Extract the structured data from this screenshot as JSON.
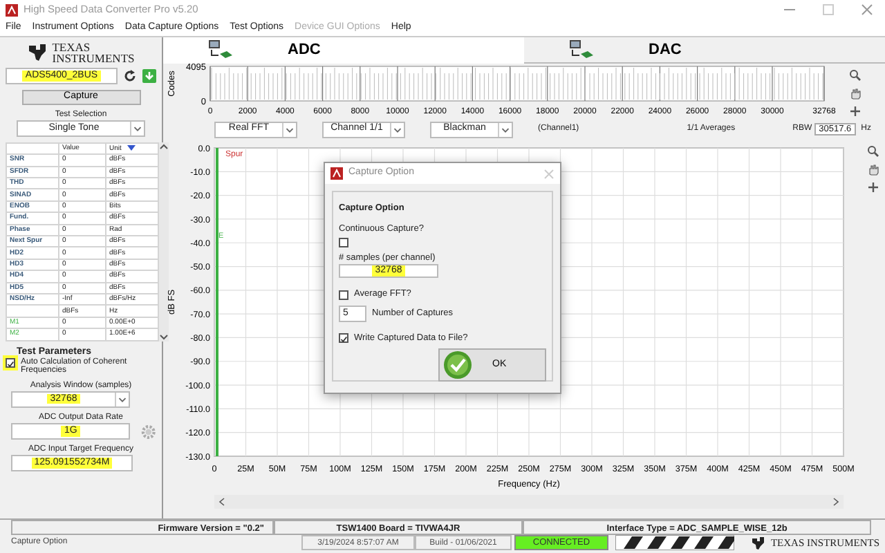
{
  "window": {
    "title": "High Speed Data Converter Pro v5.20"
  },
  "menu": [
    {
      "label": "File",
      "disabled": false
    },
    {
      "label": "Instrument Options",
      "disabled": false
    },
    {
      "label": "Data Capture Options",
      "disabled": false
    },
    {
      "label": "Test Options",
      "disabled": false
    },
    {
      "label": "Device GUI Options",
      "disabled": true
    },
    {
      "label": "Help",
      "disabled": false
    }
  ],
  "logo": {
    "line_1": "TEXAS",
    "line_2": "INSTRUMENTS"
  },
  "device": {
    "value": "ADS5400_2BUS",
    "highlighted": true
  },
  "capture_button": "Capture",
  "test_selection": {
    "label": "Test Selection",
    "value": "Single Tone"
  },
  "results": {
    "columns": [
      "Value",
      "Unit"
    ],
    "rows": [
      {
        "name": "SNR",
        "value": "0",
        "unit": "dBFs",
        "kind": "metric"
      },
      {
        "name": "SFDR",
        "value": "0",
        "unit": "dBFs",
        "kind": "metric"
      },
      {
        "name": "THD",
        "value": "0",
        "unit": "dBFs",
        "kind": "metric"
      },
      {
        "name": "SINAD",
        "value": "0",
        "unit": "dBFs",
        "kind": "metric"
      },
      {
        "name": "ENOB",
        "value": "0",
        "unit": "Bits",
        "kind": "metric"
      },
      {
        "name": "Fund.",
        "value": "0",
        "unit": "dBFs",
        "kind": "metric"
      },
      {
        "name": "Phase",
        "value": "0",
        "unit": "Rad",
        "kind": "metric"
      },
      {
        "name": "Next Spur",
        "value": "0",
        "unit": "dBFs",
        "kind": "metric"
      },
      {
        "name": "HD2",
        "value": "0",
        "unit": "dBFs",
        "kind": "metric"
      },
      {
        "name": "HD3",
        "value": "0",
        "unit": "dBFs",
        "kind": "metric"
      },
      {
        "name": "HD4",
        "value": "0",
        "unit": "dBFs",
        "kind": "metric"
      },
      {
        "name": "HD5",
        "value": "0",
        "unit": "dBFs",
        "kind": "metric"
      },
      {
        "name": "NSD/Hz",
        "value": "-Inf",
        "unit": "dBFs/Hz",
        "kind": "metric"
      },
      {
        "value": "dBFs",
        "unit": "Hz",
        "kind": "header"
      },
      {
        "name": "M1",
        "value": "0",
        "unit": "0.00E+0",
        "kind": "marker"
      },
      {
        "name": "M2",
        "value": "0",
        "unit": "1.00E+6",
        "kind": "marker"
      }
    ]
  },
  "test_parameters": {
    "title": "Test Parameters",
    "auto_coherent": {
      "label": "Auto Calculation of Coherent Frequencies",
      "checked": true,
      "highlighted": true
    },
    "fields": [
      {
        "label": "Analysis Window (samples)",
        "value": "32768",
        "kind": "select",
        "highlighted": true
      },
      {
        "label": "ADC Output Data Rate",
        "value": "1G",
        "kind": "text",
        "highlighted": true
      },
      {
        "label": "ADC Input Target Frequency",
        "value": "125.091552734M",
        "kind": "text",
        "highlighted": true
      }
    ]
  },
  "tabs": [
    {
      "label": "ADC",
      "selected": true
    },
    {
      "label": "DAC",
      "selected": false
    }
  ],
  "code_plot": {
    "chart_data": {
      "type": "line",
      "grid": true,
      "ylabel": "Codes",
      "xlim": [
        0,
        32768
      ],
      "ylim": [
        0,
        4095
      ],
      "yticks": [
        0,
        4095
      ],
      "xticks": [
        0,
        2000,
        4000,
        6000,
        8000,
        10000,
        12000,
        14000,
        16000,
        18000,
        20000,
        22000,
        24000,
        26000,
        28000,
        30000,
        32768
      ]
    }
  },
  "controls": {
    "fft_type": "Real FFT",
    "channel": "Channel 1/1",
    "window": "Blackman",
    "channel_name": "(Channel1)",
    "averages": "1/1 Averages",
    "rbw_label": "RBW",
    "rbw_value": "30517.6",
    "rbw_unit": "Hz"
  },
  "fft_plot": {
    "spur_label": "Spur",
    "marker_label": "E",
    "chart_data": {
      "type": "line",
      "grid": true,
      "xlabel": "Frequency (Hz)",
      "ylabel": "dB FS",
      "xlim": [
        0,
        500000000
      ],
      "ylim": [
        -130,
        0
      ],
      "xticks": [
        {
          "value": 0,
          "label": "0"
        },
        {
          "value": 25000000,
          "label": "25M"
        },
        {
          "value": 50000000,
          "label": "50M"
        },
        {
          "value": 75000000,
          "label": "75M"
        },
        {
          "value": 100000000,
          "label": "100M"
        },
        {
          "value": 125000000,
          "label": "125M"
        },
        {
          "value": 150000000,
          "label": "150M"
        },
        {
          "value": 175000000,
          "label": "175M"
        },
        {
          "value": 200000000,
          "label": "200M"
        },
        {
          "value": 225000000,
          "label": "225M"
        },
        {
          "value": 250000000,
          "label": "250M"
        },
        {
          "value": 275000000,
          "label": "275M"
        },
        {
          "value": 300000000,
          "label": "300M"
        },
        {
          "value": 325000000,
          "label": "325M"
        },
        {
          "value": 350000000,
          "label": "350M"
        },
        {
          "value": 375000000,
          "label": "375M"
        },
        {
          "value": 400000000,
          "label": "400M"
        },
        {
          "value": 425000000,
          "label": "425M"
        },
        {
          "value": 450000000,
          "label": "450M"
        },
        {
          "value": 475000000,
          "label": "475M"
        },
        {
          "value": 500000000,
          "label": "500M"
        }
      ],
      "yticks": [
        {
          "value": 0,
          "label": "0.0"
        },
        {
          "value": -10,
          "label": "-10.0"
        },
        {
          "value": -20,
          "label": "-20.0"
        },
        {
          "value": -30,
          "label": "-30.0"
        },
        {
          "value": -40,
          "label": "-40.0"
        },
        {
          "value": -50,
          "label": "-50.0"
        },
        {
          "value": -60,
          "label": "-60.0"
        },
        {
          "value": -70,
          "label": "-70.0"
        },
        {
          "value": -80,
          "label": "-80.0"
        },
        {
          "value": -90,
          "label": "-90.0"
        },
        {
          "value": -100,
          "label": "-100.0"
        },
        {
          "value": -110,
          "label": "-110.0"
        },
        {
          "value": -120,
          "label": "-120.0"
        },
        {
          "value": -130,
          "label": "-130.0"
        }
      ]
    }
  },
  "dialog": {
    "title": "Capture Option",
    "heading": "Capture Option",
    "continuous": {
      "label": "Continuous Capture?",
      "checked": false
    },
    "samples": {
      "label": "# samples (per channel)",
      "value": "32768",
      "highlighted": true
    },
    "average": {
      "label": "Average FFT?",
      "checked": false
    },
    "captures": {
      "value": "5",
      "label": "Number of Captures"
    },
    "write_file": {
      "label": "Write Captured Data to File?",
      "checked": true
    },
    "ok_button": "OK"
  },
  "status_bar": {
    "firmware": "Firmware Version = \"0.2\"",
    "board": "TSW1400 Board = TIVWA4JR",
    "interface": "Interface Type = ADC_SAMPLE_WISE_12b",
    "message": "Capture Option",
    "datetime": "3/19/2024 8:57:07 AM",
    "build": "Build - 01/06/2021",
    "connection": {
      "label": "CONNECTED",
      "connected": true
    },
    "logo": "TEXAS INSTRUMENTS"
  }
}
